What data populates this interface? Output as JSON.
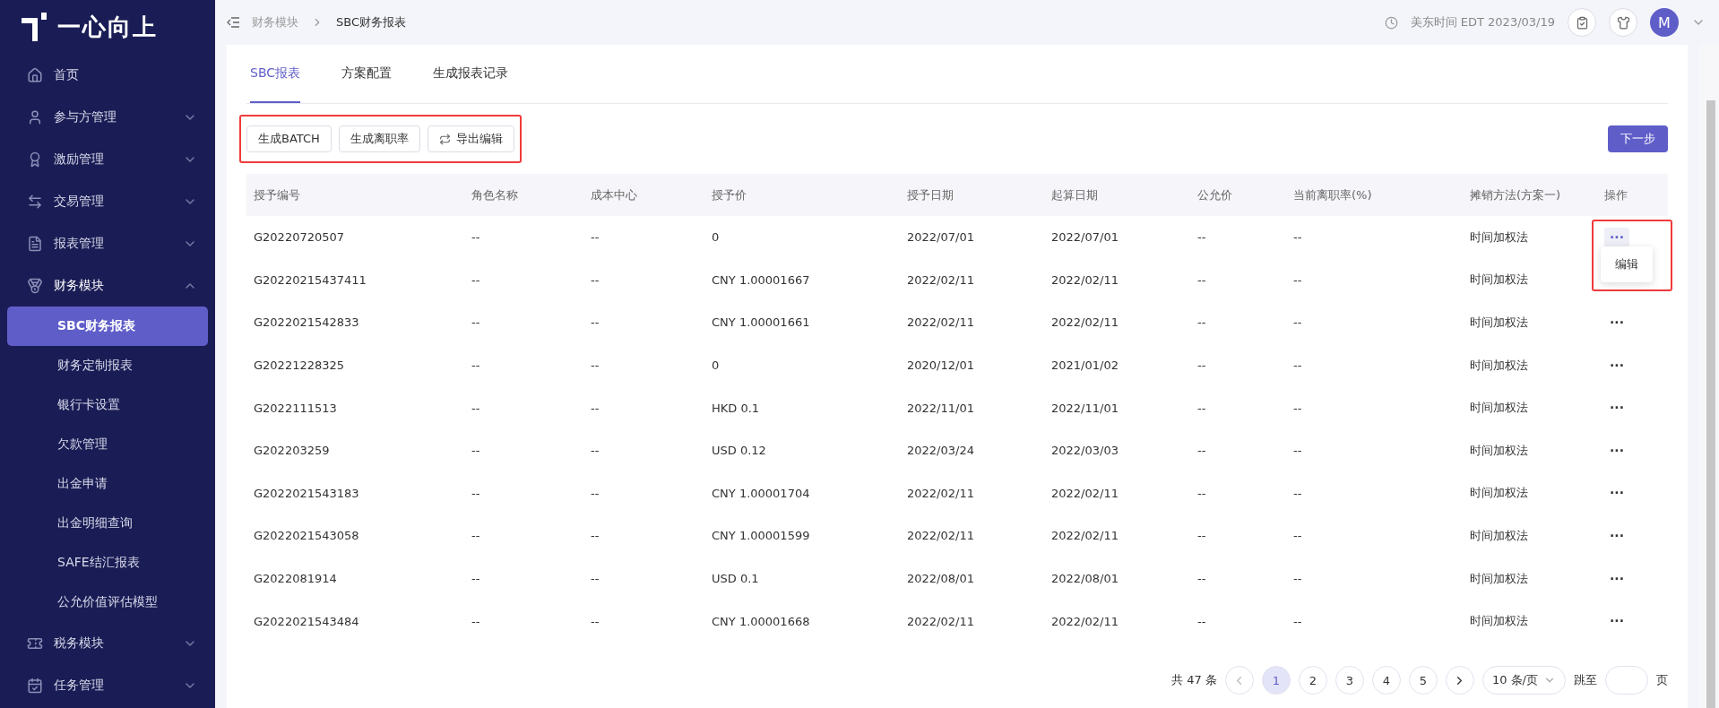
{
  "logo": {
    "text": "一心向上"
  },
  "sidebar": {
    "items": [
      {
        "label": "首页"
      },
      {
        "label": "参与方管理",
        "expanded": false
      },
      {
        "label": "激励管理",
        "expanded": false
      },
      {
        "label": "交易管理",
        "expanded": false
      },
      {
        "label": "报表管理",
        "expanded": false
      },
      {
        "label": "财务模块",
        "expanded": true,
        "children": [
          {
            "label": "SBC财务报表",
            "selected": true
          },
          {
            "label": "财务定制报表",
            "selected": false
          },
          {
            "label": "银行卡设置",
            "selected": false
          },
          {
            "label": "欠款管理",
            "selected": false
          },
          {
            "label": "出金申请",
            "selected": false
          },
          {
            "label": "出金明细查询",
            "selected": false
          },
          {
            "label": "SAFE结汇报表",
            "selected": false
          },
          {
            "label": "公允价值评估模型",
            "selected": false
          }
        ]
      },
      {
        "label": "税务模块",
        "expanded": false
      },
      {
        "label": "任务管理",
        "expanded": false
      }
    ]
  },
  "header": {
    "breadcrumb": [
      "财务模块",
      "SBC财务报表"
    ],
    "time": "美东时间 EDT 2023/03/19",
    "avatar": "M"
  },
  "tabs": [
    {
      "label": "SBC报表",
      "selected": true
    },
    {
      "label": "方案配置",
      "selected": false
    },
    {
      "label": "生成报表记录",
      "selected": false
    }
  ],
  "toolbar": {
    "buttons": [
      {
        "label": "生成BATCH",
        "kind": "plain"
      },
      {
        "label": "生成离职率",
        "kind": "plain"
      },
      {
        "label": "导出编辑",
        "kind": "icon"
      }
    ],
    "highlighted": true,
    "next_button": "下一步"
  },
  "table": {
    "columns": [
      "授予编号",
      "角色名称",
      "成本中心",
      "授予价",
      "授予日期",
      "起算日期",
      "公允价",
      "当前离职率(%)",
      "摊销方法(方案一)",
      "操作"
    ],
    "rows": [
      {
        "cells": [
          "G20220720507",
          "--",
          "--",
          "0",
          "2022/07/01",
          "2022/07/01",
          "--",
          "--",
          "时间加权法"
        ],
        "action": "···",
        "menu_open": true,
        "menu_items": [
          "编辑"
        ]
      },
      {
        "cells": [
          "G20220215437411",
          "--",
          "--",
          "CNY 1.00001667",
          "2022/02/11",
          "2022/02/11",
          "--",
          "--",
          "时间加权法"
        ]
      },
      {
        "cells": [
          "G2022021542833",
          "--",
          "--",
          "CNY 1.00001661",
          "2022/02/11",
          "2022/02/11",
          "--",
          "--",
          "时间加权法"
        ],
        "action": "···",
        "menu_open": false
      },
      {
        "cells": [
          "G20221228325",
          "--",
          "--",
          "0",
          "2020/12/01",
          "2021/01/02",
          "--",
          "--",
          "时间加权法"
        ],
        "action": "···",
        "menu_open": false
      },
      {
        "cells": [
          "G2022111513",
          "--",
          "--",
          "HKD 0.1",
          "2022/11/01",
          "2022/11/01",
          "--",
          "--",
          "时间加权法"
        ],
        "action": "···",
        "menu_open": false
      },
      {
        "cells": [
          "G202203259",
          "--",
          "--",
          "USD 0.12",
          "2022/03/24",
          "2022/03/03",
          "--",
          "--",
          "时间加权法"
        ],
        "action": "···",
        "menu_open": false
      },
      {
        "cells": [
          "G2022021543183",
          "--",
          "--",
          "CNY 1.00001704",
          "2022/02/11",
          "2022/02/11",
          "--",
          "--",
          "时间加权法"
        ],
        "action": "···",
        "menu_open": false
      },
      {
        "cells": [
          "G2022021543058",
          "--",
          "--",
          "CNY 1.00001599",
          "2022/02/11",
          "2022/02/11",
          "--",
          "--",
          "时间加权法"
        ],
        "action": "···",
        "menu_open": false
      },
      {
        "cells": [
          "G2022081914",
          "--",
          "--",
          "USD 0.1",
          "2022/08/01",
          "2022/08/01",
          "--",
          "--",
          "时间加权法"
        ],
        "action": "···",
        "menu_open": false
      },
      {
        "cells": [
          "G2022021543484",
          "--",
          "--",
          "CNY 1.00001668",
          "2022/02/11",
          "2022/02/11",
          "--",
          "--",
          "时间加权法"
        ],
        "action": "···",
        "menu_open": false
      }
    ]
  },
  "pagination": {
    "total": "共 47 条",
    "pages": [
      {
        "label": "1",
        "selected": true
      },
      {
        "label": "2",
        "selected": false
      },
      {
        "label": "3",
        "selected": false
      },
      {
        "label": "4",
        "selected": false
      },
      {
        "label": "5",
        "selected": false
      }
    ],
    "page_size": "10 条/页",
    "jump_label": "跳至",
    "page_unit": "页"
  }
}
